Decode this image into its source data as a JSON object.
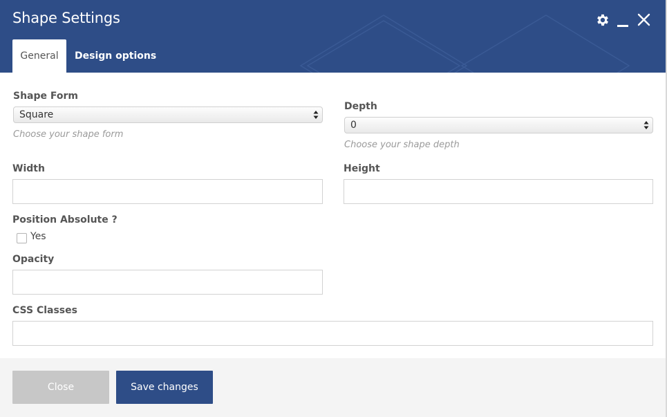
{
  "header": {
    "title": "Shape Settings",
    "icons": [
      "gear-icon",
      "minimize-icon",
      "close-icon"
    ],
    "colors": {
      "background": "#2e4d87",
      "text": "#ffffff"
    }
  },
  "tabs": [
    {
      "label": "General",
      "active": true
    },
    {
      "label": "Design options",
      "active": false
    }
  ],
  "form": {
    "shape_form": {
      "label": "Shape Form",
      "value": "Square",
      "hint": "Choose your shape form"
    },
    "depth": {
      "label": "Depth",
      "value": "0",
      "hint": "Choose your shape depth"
    },
    "width": {
      "label": "Width",
      "value": ""
    },
    "height": {
      "label": "Height",
      "value": ""
    },
    "position_absolute": {
      "label": "Position Absolute ?",
      "option_label": "Yes",
      "checked": false
    },
    "opacity": {
      "label": "Opacity",
      "value": ""
    },
    "css_classes": {
      "label": "CSS Classes",
      "value": ""
    }
  },
  "footer": {
    "close_label": "Close",
    "save_label": "Save changes",
    "colors": {
      "close_bg": "#c7c7c7",
      "save_bg": "#2e4d87"
    }
  }
}
